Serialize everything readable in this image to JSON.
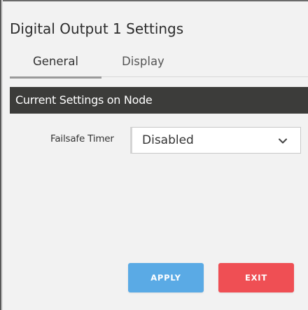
{
  "dialog": {
    "title": "Digital Output 1 Settings"
  },
  "tabs": [
    {
      "label": "General",
      "active": true
    },
    {
      "label": "Display",
      "active": false
    }
  ],
  "section": {
    "header": "Current Settings on Node"
  },
  "fields": {
    "failsafe_timer": {
      "label": "Failsafe Timer",
      "value": "Disabled",
      "icon": "chevron-down-icon"
    }
  },
  "buttons": {
    "apply_label": "APPLY",
    "exit_label": "EXIT"
  },
  "colors": {
    "section_header_bg": "#3c3c3a",
    "apply_bg": "#5aaae5",
    "exit_bg": "#ef4f54"
  }
}
